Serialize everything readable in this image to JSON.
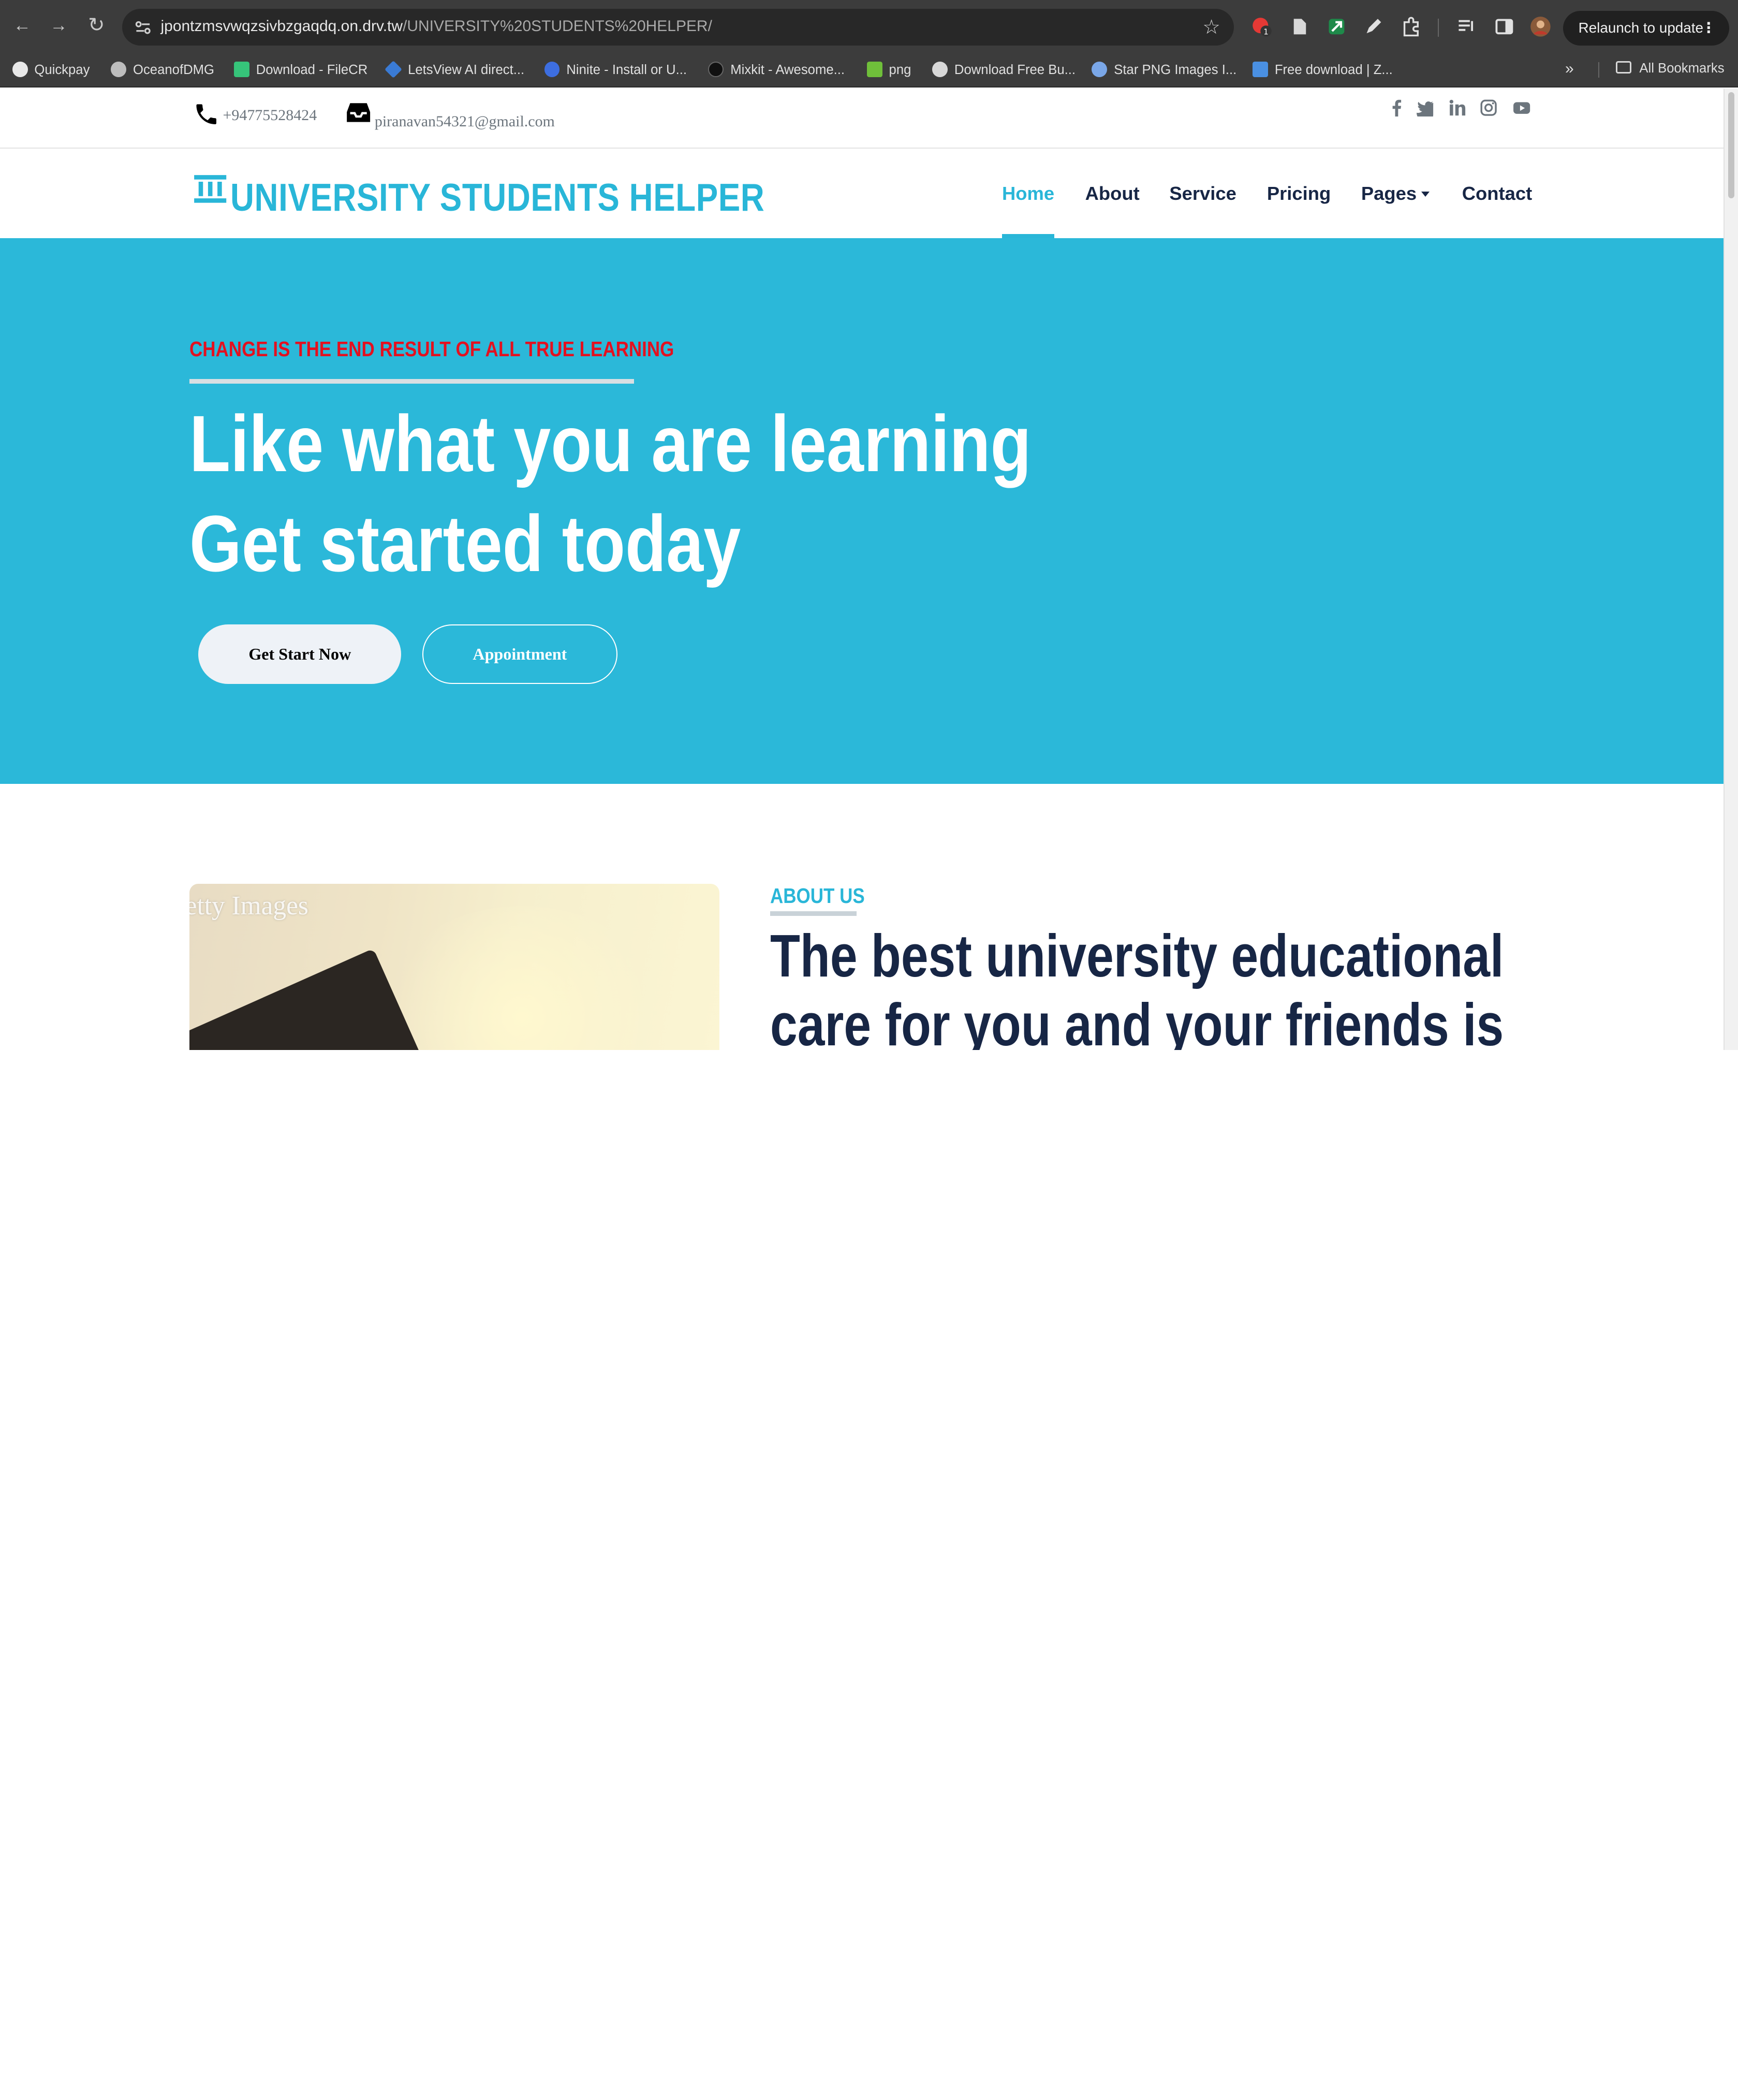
{
  "browser": {
    "url_host": "jpontzmsvwqzsivbzgaqdq.on.drv.tw",
    "url_path": "/UNIVERSITY%20STUDENTS%20HELPER/",
    "relaunch_label": "Relaunch to update",
    "bookmarks": [
      {
        "label": "Quickpay",
        "color": "#e8e8e8"
      },
      {
        "label": "OceanofDMG",
        "color": "#bdbdbd"
      },
      {
        "label": "Download - FileCR",
        "color": "#36c47a"
      },
      {
        "label": "LetsView AI direct...",
        "color": "#3a7bd5"
      },
      {
        "label": "Ninite - Install or U...",
        "color": "#3d6ee0"
      },
      {
        "label": "Mixkit - Awesome...",
        "color": "#111111"
      },
      {
        "label": "png",
        "color": "#6fbf3a"
      },
      {
        "label": "Download Free Bu...",
        "color": "#d8d8d8"
      },
      {
        "label": "Star PNG Images I...",
        "color": "#7aa7e8"
      },
      {
        "label": "Free download | Z...",
        "color": "#4a90e2"
      }
    ],
    "all_bookmarks_label": "All Bookmarks"
  },
  "topbar": {
    "phone": "+94775528424",
    "email": "piranavan54321@gmail.com",
    "social": [
      "facebook-icon",
      "twitter-icon",
      "linkedin-icon",
      "instagram-icon",
      "youtube-icon"
    ]
  },
  "navbar": {
    "logo_text": "UNIVERSITY STUDENTS HELPER",
    "items": [
      {
        "label": "Home",
        "active": true
      },
      {
        "label": "About"
      },
      {
        "label": "Service"
      },
      {
        "label": "Pricing"
      },
      {
        "label": "Pages",
        "dropdown": true
      },
      {
        "label": "Contact"
      }
    ]
  },
  "hero": {
    "tagline": "CHANGE IS THE END RESULT OF ALL TRUE LEARNING",
    "heading_line1": "Like what you are learning",
    "heading_line2": "Get started today",
    "primary_button": "Get Start Now",
    "secondary_button": "Appointment"
  },
  "about": {
    "image_watermark": "etty Images",
    "label": "ABOUT US",
    "heading_line1": "The best university educational",
    "heading_line2": "care for you and your friends is"
  },
  "colors": {
    "accent": "#29b6d8",
    "hero_bg": "#2bb8d9",
    "tagline": "#e4101f",
    "dark_text": "#172645"
  }
}
